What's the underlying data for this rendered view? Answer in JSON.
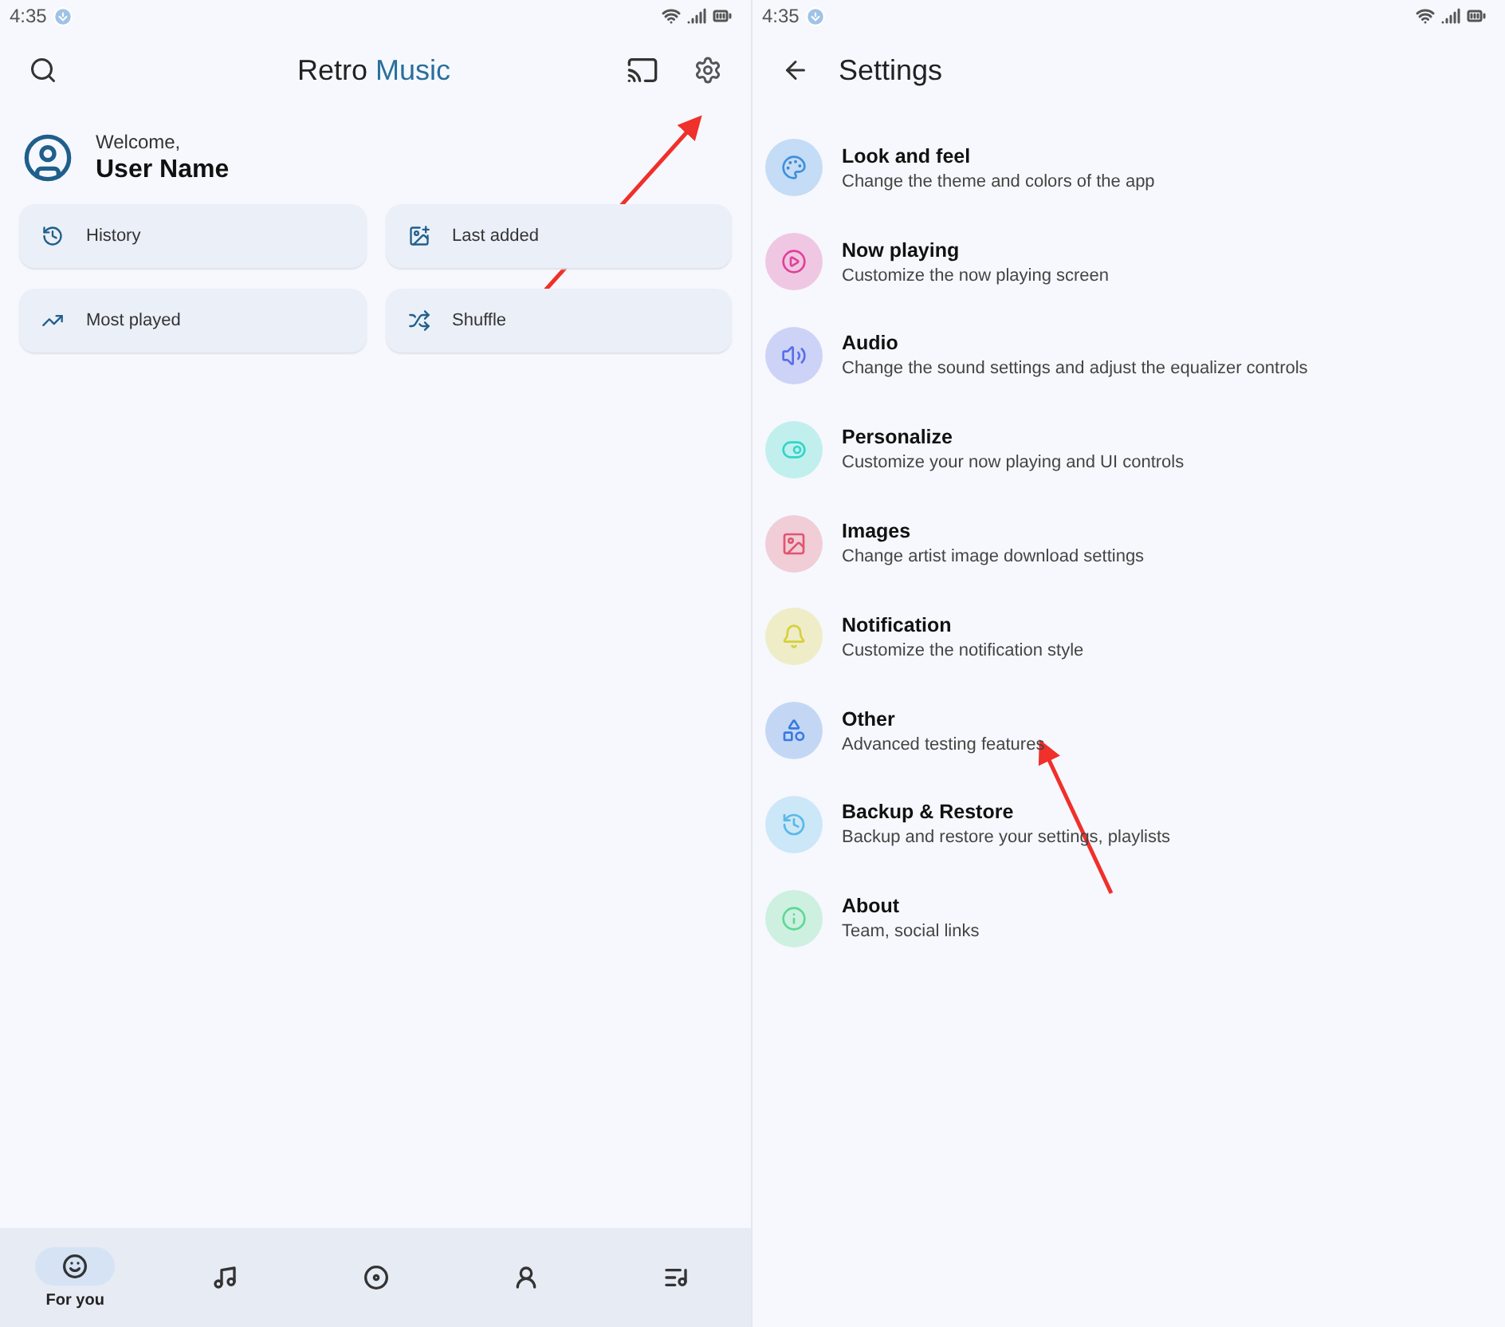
{
  "home": {
    "status_bar": {
      "time": "4:35"
    },
    "title": {
      "first": "Retro",
      "second": "Music"
    },
    "welcome": {
      "greeting": "Welcome,",
      "name": "User Name"
    },
    "shortcuts": [
      {
        "kind": "history",
        "label": "History"
      },
      {
        "kind": "added",
        "label": "Last added"
      },
      {
        "kind": "trend",
        "label": "Most played"
      },
      {
        "kind": "shuffle",
        "label": "Shuffle"
      }
    ],
    "nav": [
      {
        "kind": "face",
        "label": "For you",
        "selected": true
      },
      {
        "kind": "note",
        "selected": false
      },
      {
        "kind": "disc",
        "selected": false
      },
      {
        "kind": "artist",
        "selected": false
      },
      {
        "kind": "playlist",
        "selected": false
      }
    ]
  },
  "settings": {
    "status_bar": {
      "time": "4:35"
    },
    "title": "Settings",
    "items": [
      {
        "kind": "palette",
        "title": "Look and feel",
        "subtitle": "Change the theme and colors of the app",
        "color": "#3d8fe0"
      },
      {
        "kind": "play",
        "title": "Now playing",
        "subtitle": "Customize the now playing screen",
        "color": "#e0409a"
      },
      {
        "kind": "audio",
        "title": "Audio",
        "subtitle": "Change the sound settings and adjust the equalizer controls",
        "color": "#5a6ee8"
      },
      {
        "kind": "toggle",
        "title": "Personalize",
        "subtitle": "Customize your now playing and UI controls",
        "color": "#2fd6c8"
      },
      {
        "kind": "image",
        "title": "Images",
        "subtitle": "Change artist image download settings",
        "color": "#e05570"
      },
      {
        "kind": "bell",
        "title": "Notification",
        "subtitle": "Customize the notification style",
        "color": "#d8cf3a"
      },
      {
        "kind": "shapes",
        "title": "Other",
        "subtitle": "Advanced testing features",
        "color": "#3a7ae0"
      },
      {
        "kind": "restore",
        "title": "Backup & Restore",
        "subtitle": "Backup and restore your settings, playlists",
        "color": "#5ab8e8"
      },
      {
        "kind": "info",
        "title": "About",
        "subtitle": "Team, social links",
        "color": "#5ed894"
      }
    ]
  }
}
